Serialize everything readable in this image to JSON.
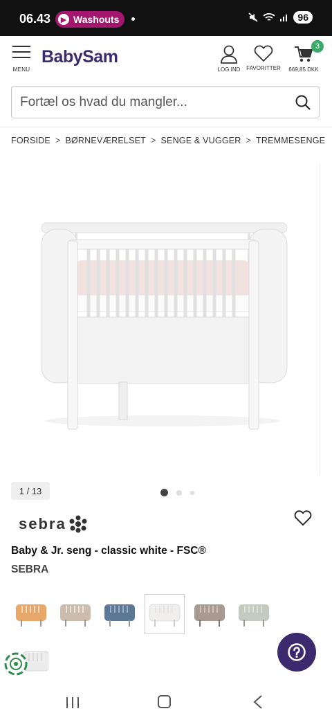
{
  "status_bar": {
    "time": "06.43",
    "notification_app": "Washouts",
    "battery": "96"
  },
  "header": {
    "menu_label": "MENU",
    "logo": "BabySam",
    "login_label": "LOG IND",
    "favorites_label": "FAVORITTER",
    "cart_count": "3",
    "cart_total": "669,85 DKK"
  },
  "search": {
    "placeholder": "Fortæl os hvad du mangler..."
  },
  "breadcrumb": {
    "items": [
      "FORSIDE",
      "BØRNEVÆRELSET",
      "SENGE & VUGGER",
      "TREMMESENGE"
    ],
    "separator": ">"
  },
  "gallery": {
    "counter": "1 / 13",
    "current_index": 1,
    "total": 13
  },
  "product": {
    "brand_logo": "sebra",
    "title": "Baby & Jr. seng - classic white - FSC®",
    "brand": "SEBRA"
  },
  "variants": [
    {
      "color": "#e8a86a",
      "selected": false
    },
    {
      "color": "#cbbcae",
      "selected": false
    },
    {
      "color": "#5d7796",
      "selected": false
    },
    {
      "color": "#f0efed",
      "selected": true
    },
    {
      "color": "#a89a90",
      "selected": false
    },
    {
      "color": "#c3cabf",
      "selected": false
    },
    {
      "color": "#ececec",
      "selected": false
    }
  ],
  "colors": {
    "brand": "#3c2a6e",
    "badge_green": "#3aa96a",
    "notification_pill": "#a3186e"
  },
  "icons": [
    "menu-icon",
    "user-icon",
    "heart-icon",
    "cart-icon",
    "search-icon",
    "help-icon",
    "eco-icon"
  ]
}
